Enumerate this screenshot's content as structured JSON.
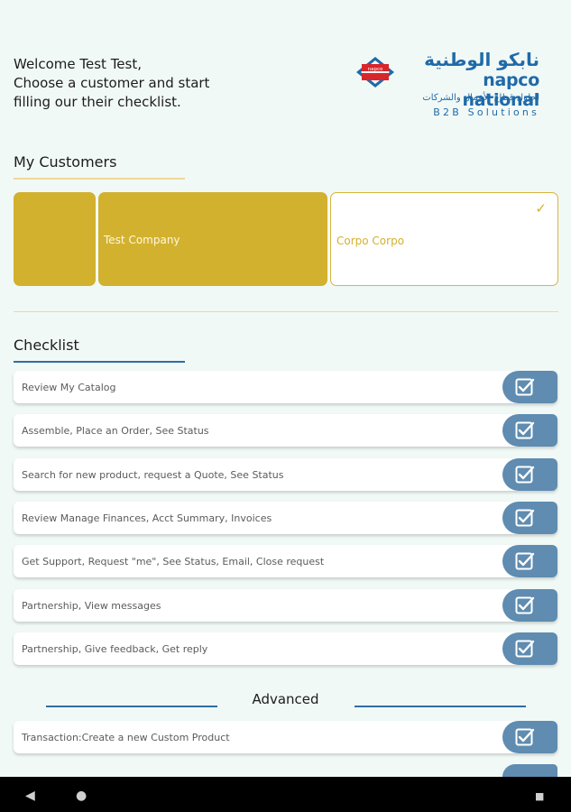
{
  "welcome": {
    "line1": "Welcome Test Test,",
    "line2": "Choose a customer and start",
    "line3": "filling our their checklist."
  },
  "logo": {
    "arabic_name": "نابكو الوطنية",
    "english_name": "napco national",
    "arabic_tagline": "لحلول قطاع الأعمال والشركات",
    "b2b": "B2B Solutions",
    "seal_label": "napco"
  },
  "customers": {
    "title": "My Customers",
    "items": [
      {
        "name": "",
        "selected": false
      },
      {
        "name": "Test Company",
        "selected": false
      },
      {
        "name": "Corpo Corpo",
        "selected": true
      }
    ]
  },
  "checklist": {
    "title": "Checklist",
    "items": [
      {
        "label": "Review My Catalog"
      },
      {
        "label": "Assemble, Place an Order, See Status"
      },
      {
        "label": "Search for new product, request a Quote, See Status"
      },
      {
        "label": "Review Manage Finances, Acct Summary, Invoices"
      },
      {
        "label": "Get Support, Request \"me\", See Status, Email, Close request"
      },
      {
        "label": "Partnership, View messages"
      },
      {
        "label": "Partnership, Give feedback, Get reply"
      }
    ]
  },
  "advanced": {
    "title": "Advanced",
    "items": [
      {
        "label": "Transaction:Create a new Custom Product"
      }
    ]
  },
  "navbar": {
    "back": "◀",
    "home": "●",
    "recents": "■"
  },
  "colors": {
    "background": "#f1f9f6",
    "gold": "#d2b12f",
    "check_button": "#5f8cb0",
    "underline_blue": "#2f6ea3",
    "brand_blue": "#1f6aa9"
  }
}
